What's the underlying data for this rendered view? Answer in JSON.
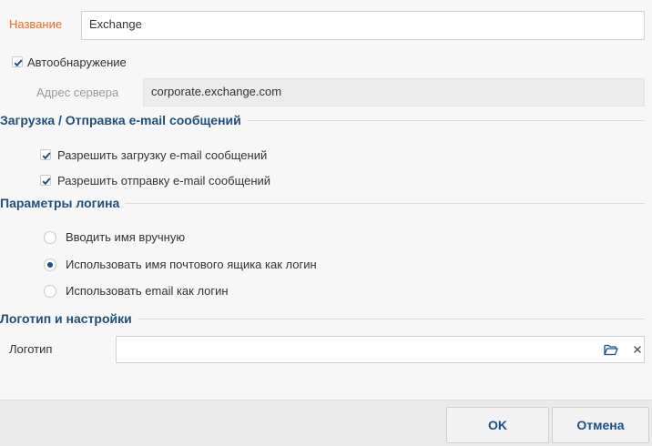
{
  "name_field": {
    "label": "Название",
    "value": "Exchange",
    "label_color": "#f26b24"
  },
  "autodetect": {
    "label": "Автообнаружение",
    "checked": true
  },
  "server": {
    "label": "Адрес сервера",
    "value": "corporate.exchange.com"
  },
  "mail_section": {
    "title": "Загрузка / Отправка e-mail сообщений",
    "allow_download": {
      "label": "Разрешить загрузку e-mail сообщений",
      "checked": true
    },
    "allow_send": {
      "label": "Разрешить отправку e-mail сообщений",
      "checked": true
    }
  },
  "login_section": {
    "title": "Параметры логина",
    "options": [
      {
        "label": "Вводить имя вручную",
        "selected": false
      },
      {
        "label": "Использовать имя почтового ящика как логин",
        "selected": true
      },
      {
        "label": "Использовать email как логин",
        "selected": false
      }
    ]
  },
  "logo_section": {
    "title": "Логотип и настройки",
    "logo_label": "Логотип",
    "logo_value": "",
    "icons": {
      "browse": "folder-open-icon",
      "clear": "close-icon"
    }
  },
  "footer": {
    "ok_label": "OK",
    "cancel_label": "Отмена"
  },
  "colors": {
    "accent": "#1c4f83",
    "section_title": "#1f4e7a",
    "required_label": "#f26b24"
  }
}
